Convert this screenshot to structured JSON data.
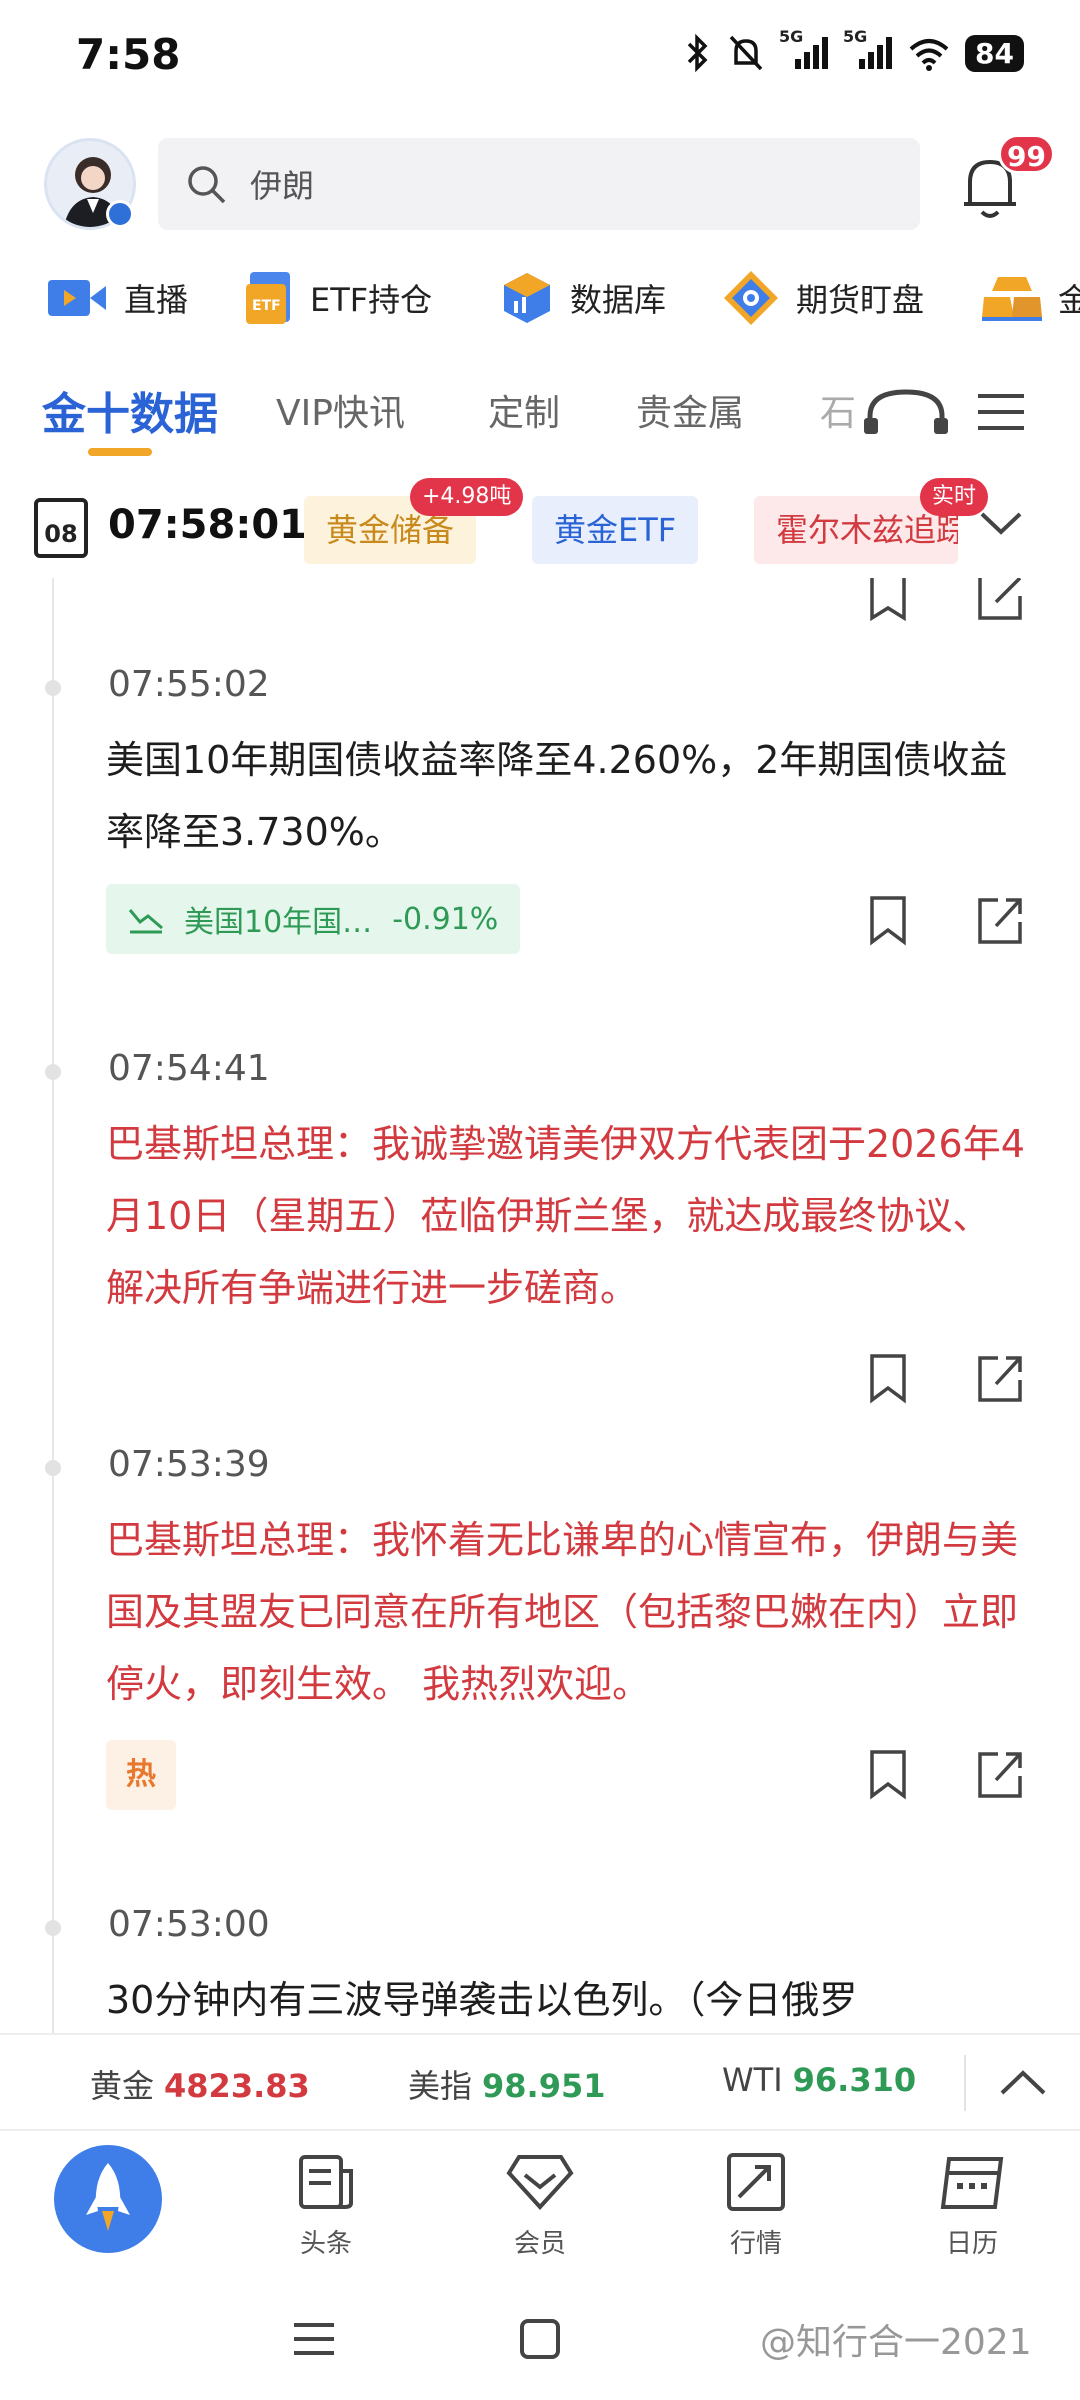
{
  "status_bar": {
    "time": "7:58",
    "battery": "84",
    "network_labels": [
      "5G",
      "5G"
    ]
  },
  "header": {
    "search_placeholder": "伊朗",
    "notification_count": "99"
  },
  "quick_nav": [
    {
      "label": "直播",
      "icon": "live-video-icon"
    },
    {
      "label": "ETF持仓",
      "icon": "etf-icon"
    },
    {
      "label": "数据库",
      "icon": "database-cube-icon"
    },
    {
      "label": "期货盯盘",
      "icon": "futures-target-icon"
    },
    {
      "label": "金",
      "icon": "gold-bars-icon"
    }
  ],
  "tabs": [
    {
      "label": "金十数据",
      "active": true
    },
    {
      "label": "VIP快讯",
      "active": false
    },
    {
      "label": "定制",
      "active": false
    },
    {
      "label": "贵金属",
      "active": false
    },
    {
      "label": "石",
      "active": false
    }
  ],
  "ticker": {
    "calendar_day": "08",
    "clock": "07:58:01",
    "chips": [
      {
        "label": "黄金储备",
        "badge": "+4.98吨"
      },
      {
        "label": "黄金ETF",
        "badge": ""
      },
      {
        "label": "霍尔木兹追踪",
        "badge": "实时"
      }
    ]
  },
  "feed": [
    {
      "time": "07:55:02",
      "text": "美国10年期国债收益率降至4.260%，2年期国债收益率降至3.730%。",
      "highlight": false,
      "tag": {
        "type": "quote",
        "label": "美国10年国…",
        "change": "-0.91%"
      }
    },
    {
      "time": "07:54:41",
      "text": "巴基斯坦总理：我诚挚邀请美伊双方代表团于2026年4月10日（星期五）莅临伊斯兰堡，就达成最终协议、解决所有争端进行进一步磋商。",
      "highlight": true
    },
    {
      "time": "07:53:39",
      "text": "巴基斯坦总理：我怀着无比谦卑的心情宣布，伊朗与美国及其盟友已同意在所有地区（包括黎巴嫩在内）立即停火，即刻生效。 我热烈欢迎。",
      "highlight": true,
      "tag": {
        "type": "hot",
        "label": "热"
      }
    },
    {
      "time": "07:53:00",
      "text": "30分钟内有三波导弹袭击以色列。（今日俄罗",
      "highlight": false
    }
  ],
  "price_bar": [
    {
      "name": "黄金",
      "value": "4823.83",
      "color": "#d23a3f"
    },
    {
      "name": "美指",
      "value": "98.951",
      "color": "#2e9a56"
    },
    {
      "name": "WTI",
      "value": "96.310",
      "color": "#2e9a56"
    }
  ],
  "bottom_nav": [
    {
      "label": "头条",
      "icon": "headline-icon"
    },
    {
      "label": "会员",
      "icon": "vip-diamond-icon"
    },
    {
      "label": "行情",
      "icon": "market-trend-icon"
    },
    {
      "label": "日历",
      "icon": "calendar-icon"
    }
  ],
  "watermark": "@知行合一2021"
}
